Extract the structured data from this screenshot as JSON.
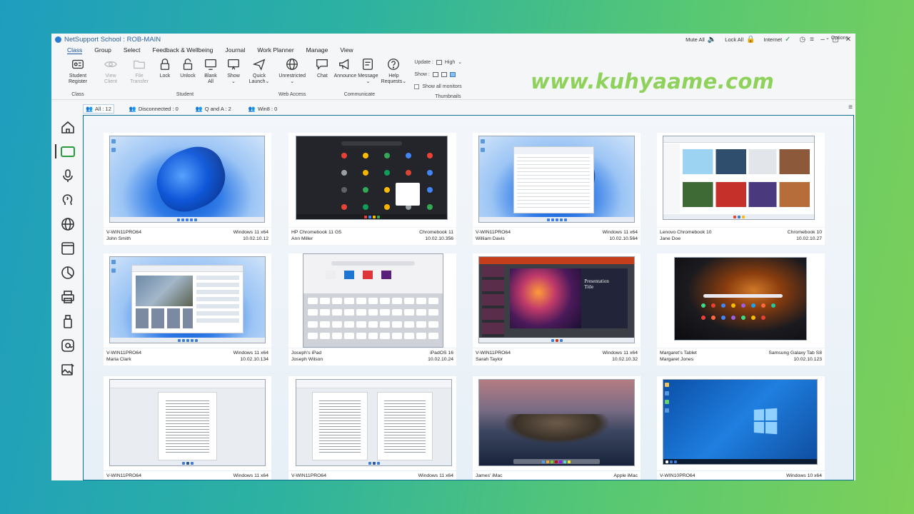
{
  "window": {
    "title": "NetSupport School : ROB-MAIN",
    "mute_all": "Mute All",
    "lock_all": "Lock All",
    "internet": "Internet",
    "options": "Options",
    "options_icon": "chevron-down-icon"
  },
  "menu": [
    "Class",
    "Group",
    "Select",
    "Feedback & Wellbeing",
    "Journal",
    "Work Planner",
    "Manage",
    "View"
  ],
  "ribbon": {
    "class_group": {
      "label": "Class",
      "buttons": [
        {
          "label": "Student\nRegister",
          "icon": "id-card-icon"
        }
      ]
    },
    "student_group": {
      "label": "Student",
      "buttons": [
        {
          "label": "View\nClient",
          "icon": "eye-icon",
          "disabled": true
        },
        {
          "label": "File\nTransfer",
          "icon": "folder-icon",
          "disabled": true
        },
        {
          "label": "Lock",
          "icon": "lock-icon"
        },
        {
          "label": "Unlock",
          "icon": "unlock-icon"
        },
        {
          "label": "Blank\nAll",
          "icon": "monitor-icon"
        },
        {
          "label": "Show\n⌄",
          "icon": "monitor-share-icon"
        },
        {
          "label": "Quick\nLaunch⌄",
          "icon": "send-icon"
        }
      ]
    },
    "web_group": {
      "label": "Web Access",
      "buttons": [
        {
          "label": "Unrestricted\n⌄",
          "icon": "globe-icon"
        }
      ]
    },
    "communicate_group": {
      "label": "Communicate",
      "buttons": [
        {
          "label": "Chat",
          "icon": "chat-icon"
        },
        {
          "label": "Announce",
          "icon": "megaphone-icon"
        },
        {
          "label": "Message\n⌄",
          "icon": "message-icon"
        },
        {
          "label": "Help\nRequests⌄",
          "icon": "help-icon"
        }
      ]
    },
    "thumbnails_group": {
      "label": "Thumbnails",
      "update_label": "Update :",
      "update_value": "High",
      "show_label": "Show :",
      "show_all_monitors": "Show all monitors"
    }
  },
  "watermark": "www.kuhyaame.com",
  "tabs": [
    {
      "label": "All : 12",
      "active": true
    },
    {
      "label": "Disconnected : 0"
    },
    {
      "label": "Q and A : 2"
    },
    {
      "label": "Win8 : 0"
    }
  ],
  "sidebar": [
    "home-icon",
    "screens-icon",
    "microphone-icon",
    "brain-icon",
    "globe-icon",
    "browser-window-icon",
    "pie-chart-icon",
    "printer-icon",
    "usb-drive-icon",
    "at-sign-icon",
    "image-edit-icon"
  ],
  "clients": [
    {
      "name": "V-WIN11PRO64",
      "os": "Windows 11 x64",
      "user": "John Smith",
      "ip": "10.02.10.12",
      "screen": "win11"
    },
    {
      "name": "HP Chromebook 11 G5",
      "os": "Chromebook 11",
      "user": "Ann Miller",
      "ip": "10.02.10.356",
      "screen": "chromeos"
    },
    {
      "name": "V-WIN11PRO64",
      "os": "Windows 11 x64",
      "user": "William Davis",
      "ip": "10.02.10.564",
      "screen": "win11-explorer"
    },
    {
      "name": "Lenovo Chromebook 10",
      "os": "Chromebook 10",
      "user": "Jane Doe",
      "ip": "10.02.10.27",
      "screen": "browser"
    },
    {
      "name": "V-WIN11PRO64",
      "os": "Windows 11 x64",
      "user": "Maria Clark",
      "ip": "10.02.10.134",
      "screen": "win11-browser"
    },
    {
      "name": "Joseph's iPad",
      "os": "iPadOS 16",
      "user": "Joseph Wilson",
      "ip": "10.02.10.24",
      "screen": "ipad"
    },
    {
      "name": "V-WIN11PRO64",
      "os": "Windows 11 x64",
      "user": "Sarah Taylor",
      "ip": "10.02.10.32",
      "screen": "ppt"
    },
    {
      "name": "Margaret's Tablet",
      "os": "Samsung Galaxy Tab S8",
      "user": "Margaret Jones",
      "ip": "10.02.10.123",
      "screen": "galaxy"
    },
    {
      "name": "V-WIN11PRO64",
      "os": "Windows 11 x64",
      "user": "",
      "ip": "",
      "screen": "word1"
    },
    {
      "name": "V-WIN11PRO64",
      "os": "Windows 11 x64",
      "user": "",
      "ip": "",
      "screen": "word2"
    },
    {
      "name": "James' iMac",
      "os": "Apple iMac",
      "user": "",
      "ip": "",
      "screen": "mac"
    },
    {
      "name": "V-WIN10PRO64",
      "os": "Windows 10 x64",
      "user": "",
      "ip": "",
      "screen": "win10"
    }
  ],
  "colors": {
    "accent": "#1a4f9c",
    "watermark": "#8ed25b",
    "content_border": "#0e6f91"
  }
}
